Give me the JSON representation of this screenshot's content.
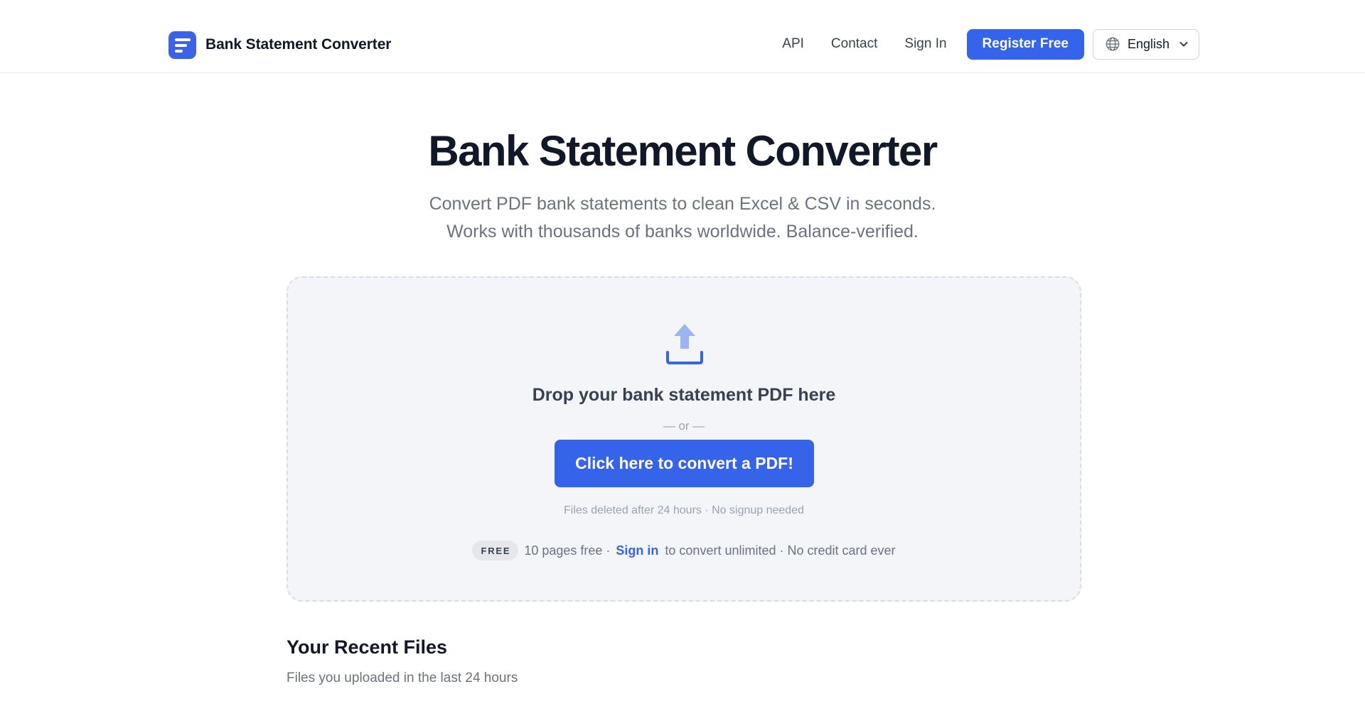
{
  "header": {
    "brand_name": "Bank Statement Converter",
    "nav": {
      "api": "API",
      "contact": "Contact",
      "sign_in": "Sign In",
      "register": "Register Free"
    },
    "language": {
      "selected": "English",
      "icon": "globe-icon"
    }
  },
  "hero": {
    "title": "Bank Statement Converter",
    "subtitle_line1": "Convert PDF bank statements to clean Excel & CSV in seconds.",
    "subtitle_line2": "Works with thousands of banks worldwide. Balance-verified."
  },
  "dropzone": {
    "icon": "upload-icon",
    "drop_text": "Drop your bank statement PDF here",
    "or_text": "— or —",
    "convert_button": "Click here to convert a PDF!",
    "note": "Files deleted after 24 hours · No signup needed",
    "free_badge": "FREE",
    "free_text_before": "10 pages free ·",
    "sign_in_link": "Sign in",
    "free_text_after": "to convert unlimited · No credit card ever"
  },
  "recent_files": {
    "title": "Your Recent Files",
    "subtitle": "Files you uploaded in the last 24 hours"
  },
  "colors": {
    "accent": "#3563e9",
    "dropzone_bg": "#f3f5f9",
    "upload_icon": "#9db4f2"
  }
}
